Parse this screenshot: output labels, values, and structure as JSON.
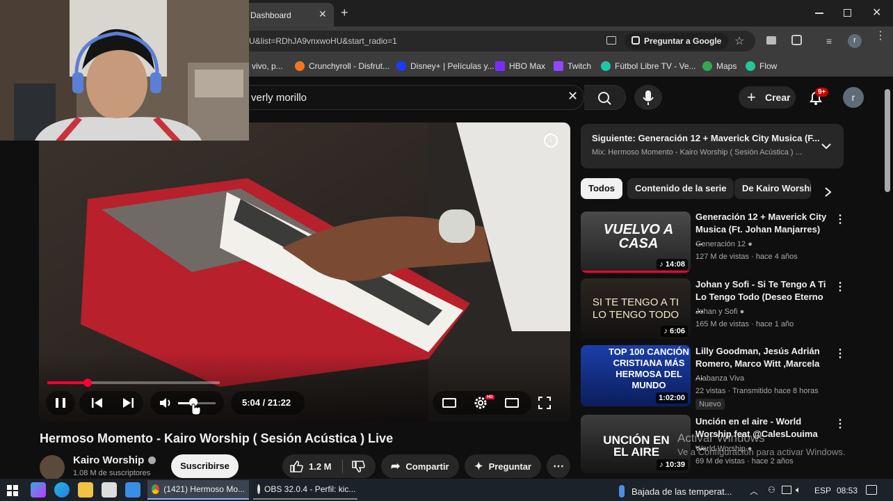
{
  "browser": {
    "tab_title": "Dashboard",
    "url_fragment": "U&list=RDhJA9vnxwoHU&start_radio=1",
    "ask_google_label": "Preguntar a Google",
    "profile_initial": "r",
    "bookmarks": [
      {
        "label": "vivo, p...",
        "color": "#ff6a00"
      },
      {
        "label": "Crunchyroll - Disfrut...",
        "color": "#f47521"
      },
      {
        "label": "Disney+ | Películas y...",
        "color": "#1a3cff"
      },
      {
        "label": "HBO Max",
        "color": "#7b2cff"
      },
      {
        "label": "Twitch",
        "color": "#9146ff"
      },
      {
        "label": "Fútbol Libre TV - Ve...",
        "color": "#1ec8a5"
      },
      {
        "label": "Maps",
        "color": "#34a853"
      },
      {
        "label": "Flow",
        "color": "#20c997"
      }
    ]
  },
  "youtube": {
    "search_query": "verly morillo",
    "create_label": "Crear",
    "notification_count": "9+",
    "avatar_initial": "r",
    "player": {
      "progress_fraction": 0.235,
      "time_display": "5:04 / 21:22"
    },
    "video_title": "Hermoso Momento - Kairo Worship ( Sesión Acústica ) Live",
    "channel_name": "Kairo Worship",
    "subscribers": "1.08 M de suscriptores",
    "subscribe_label": "Suscribirse",
    "likes": "1.2 M",
    "share_label": "Compartir",
    "ask_label": "Preguntar",
    "next_up": {
      "title": "Siguiente: Generación 12 + Maverick City Musica (F...",
      "subtitle": "Mix: Hermoso Momento - Kairo Worship ( Sesión Acústica ) ..."
    },
    "chips": [
      "Todos",
      "Contenido de la serie",
      "De Kairo Worship"
    ],
    "recommendations": [
      {
        "title": "Generación 12 + Maverick City Musica (Ft. Johan Manjarres) ...",
        "channel": "Generación 12",
        "meta": "127 M de vistas · hace 4 años",
        "duration": "14:08",
        "thumb_text": "VUELVO A CASA",
        "badge": ""
      },
      {
        "title": "Johan y Sofi - Si Te Tengo A Ti Lo Tengo Todo (Deseo Eterno ...",
        "channel": "Johan y Sofi",
        "meta": "165 M de vistas · hace 1 año",
        "duration": "6:06",
        "thumb_text": "SI TE TENGO A TI LO TENGO TODO",
        "badge": ""
      },
      {
        "title": "Lilly Goodman, Jesús Adrián Romero, Marco Witt ,Marcela ...",
        "channel": "Alabanza Viva",
        "meta": "22 vistas · Transmitido hace 8 horas",
        "duration": "1:02:00",
        "thumb_text": "TOP 100 CANCIÓN CRISTIANA MÁS HERMOSA DEL MUNDO",
        "badge": "Nuevo"
      },
      {
        "title": "Unción en el aire - World Worship feat @CalesLouima -...",
        "channel": "World Worship",
        "meta": "69 M de vistas · hace 2 años",
        "duration": "10:39",
        "thumb_text": "UNCIÓN EN EL AIRE",
        "badge": ""
      }
    ]
  },
  "watermark": {
    "line1": "Activar Windows",
    "line2": "Ve a Configuración para activar Windows."
  },
  "taskbar": {
    "apps": [
      {
        "label": "(1421) Hermoso Mo..."
      },
      {
        "label": "OBS 32.0.4 - Perfil: kic..."
      }
    ],
    "weather": "Bajada de las temperat...",
    "lang": "ESP",
    "time": "08:53"
  }
}
